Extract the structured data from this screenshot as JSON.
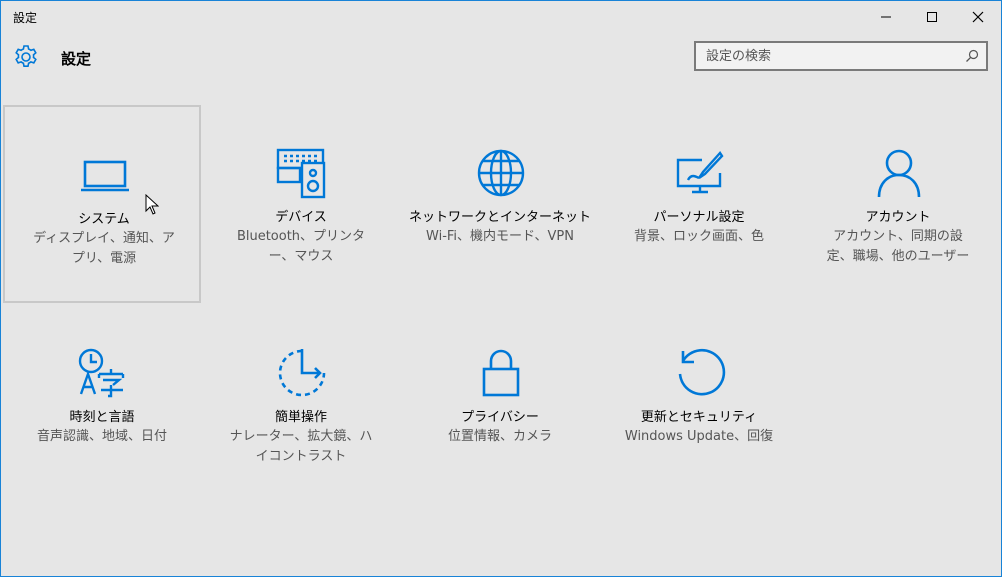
{
  "window": {
    "title": "設定"
  },
  "header": {
    "title": "設定"
  },
  "search": {
    "placeholder": "設定の検索"
  },
  "accent_color": "#0078d7",
  "categories": [
    {
      "name": "システム",
      "description": "ディスプレイ、通知、アプリ、電源",
      "icon": "laptop-icon"
    },
    {
      "name": "デバイス",
      "description": "Bluetooth、プリンター、マウス",
      "icon": "devices-icon"
    },
    {
      "name": "ネットワークとインターネット",
      "description": "Wi-Fi、機内モード、VPN",
      "icon": "globe-icon"
    },
    {
      "name": "パーソナル設定",
      "description": "背景、ロック画面、色",
      "icon": "personalization-icon"
    },
    {
      "name": "アカウント",
      "description": "アカウント、同期の設定、職場、他のユーザー",
      "icon": "person-icon"
    },
    {
      "name": "時刻と言語",
      "description": "音声認識、地域、日付",
      "icon": "time-language-icon"
    },
    {
      "name": "簡単操作",
      "description": "ナレーター、拡大鏡、ハイコントラスト",
      "icon": "ease-of-access-icon"
    },
    {
      "name": "プライバシー",
      "description": "位置情報、カメラ",
      "icon": "lock-icon"
    },
    {
      "name": "更新とセキュリティ",
      "description": "Windows Update、回復",
      "icon": "update-icon"
    }
  ]
}
